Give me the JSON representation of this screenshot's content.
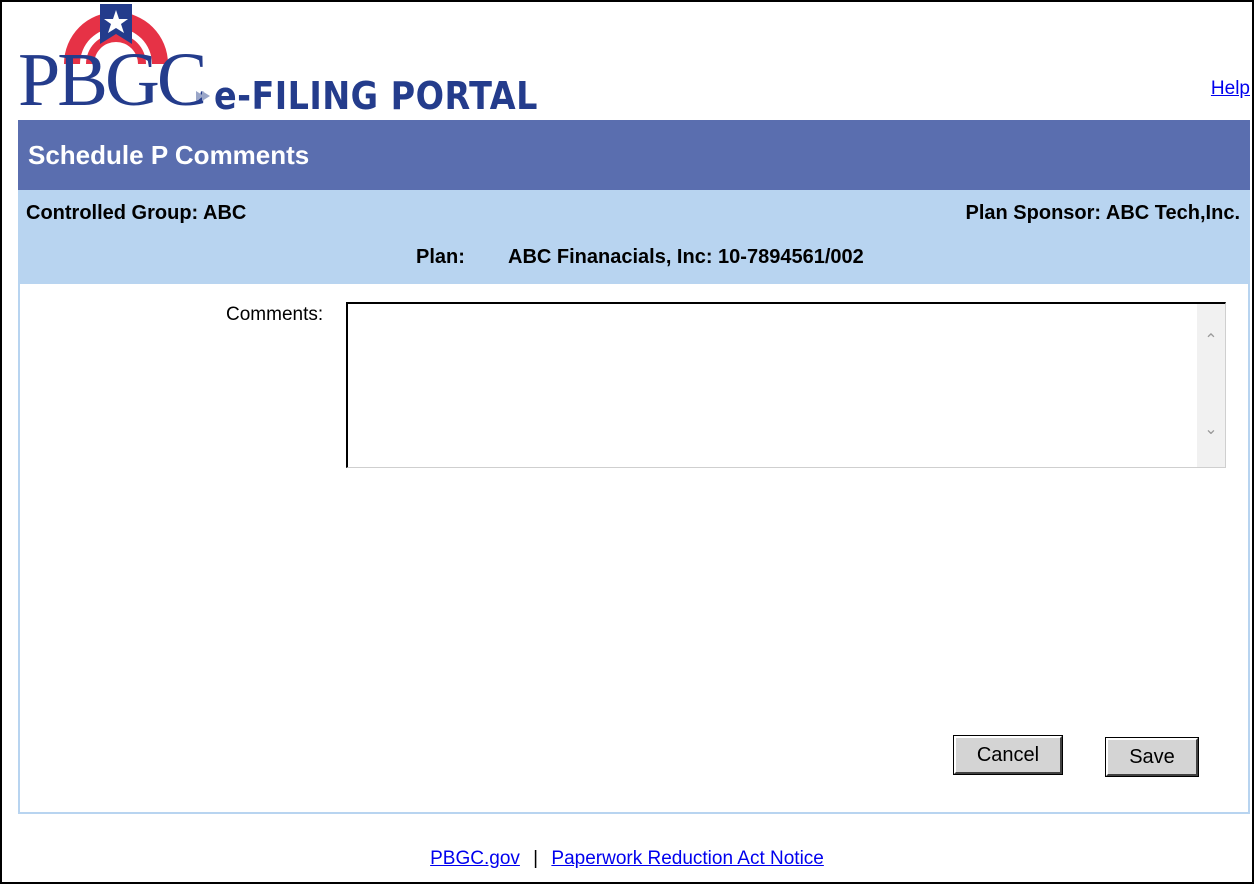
{
  "header": {
    "logo_text": "PBGC",
    "portal_text": "e-FILING PORTAL",
    "help_link": "Help",
    "colors": {
      "logo_blue": "#243c8c",
      "logo_red": "#e63246"
    }
  },
  "title_bar": {
    "title": "Schedule P Comments",
    "background": "#5a6eaf"
  },
  "info_bar": {
    "controlled_group_label": "Controlled Group:",
    "controlled_group_value": "ABC",
    "plan_sponsor_label": "Plan Sponsor:",
    "plan_sponsor_value": "ABC Tech,Inc.",
    "plan_label": "Plan:",
    "plan_value": "ABC Finanacials, Inc: 10-7894561/002",
    "background": "#b8d4f0"
  },
  "form": {
    "comments_label": "Comments:",
    "comments_value": "",
    "cancel_label": "Cancel",
    "save_label": "Save"
  },
  "footer": {
    "pbgc_link": "PBGC.gov",
    "separator": "|",
    "paperwork_link": "Paperwork Reduction Act Notice"
  }
}
